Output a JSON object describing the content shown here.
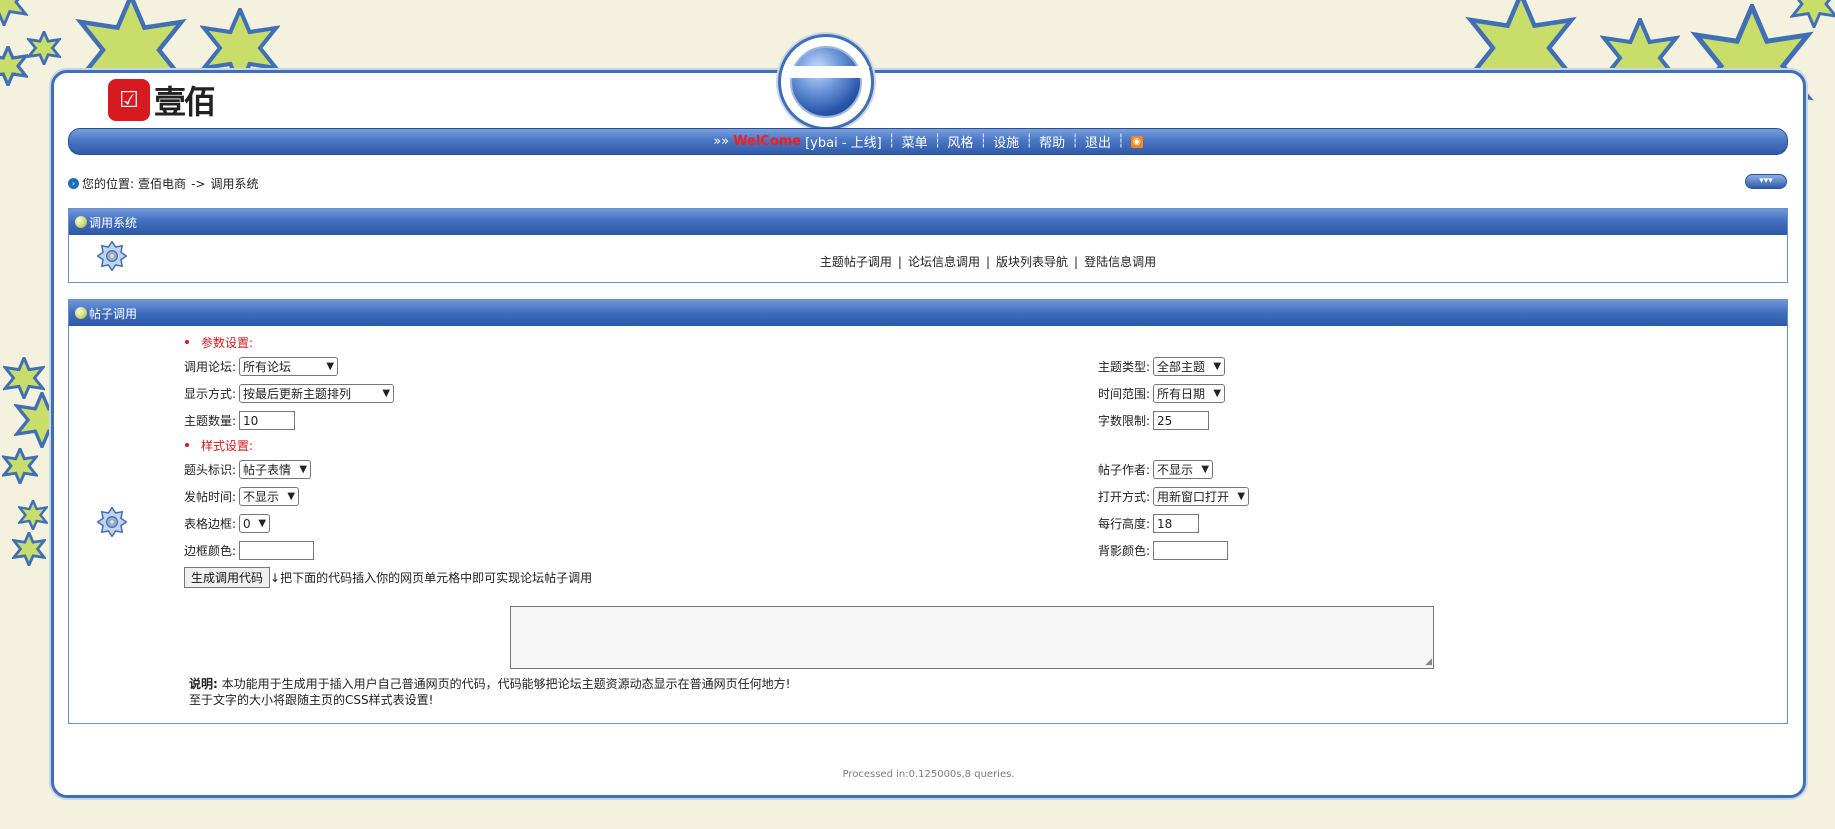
{
  "header": {
    "logo_mark": "☑",
    "logo_text": "壹佰",
    "nav": {
      "prefix": "»»",
      "welcome": "WelCome",
      "user_status": "[ybai - 上线]",
      "items": [
        "菜单",
        "风格",
        "设施",
        "帮助",
        "退出"
      ],
      "rss_icon": "rss-icon"
    }
  },
  "breadcrumb": {
    "label": "您的位置:",
    "site": "壹佰电商",
    "separator": "->",
    "current": "调用系统"
  },
  "panel_system": {
    "title": "调用系统",
    "links": [
      "主题帖子调用",
      "论坛信息调用",
      "版块列表导航",
      "登陆信息调用"
    ]
  },
  "panel_post": {
    "title": "帖子调用",
    "params_title": "参数设置:",
    "style_title": "样式设置:",
    "fields": {
      "forum_label": "调用论坛:",
      "forum_value": "所有论坛",
      "topic_type_label": "主题类型:",
      "topic_type_value": "全部主题",
      "display_label": "显示方式:",
      "display_value": "按最后更新主题排列",
      "time_label": "时间范围:",
      "time_value": "所有日期",
      "count_label": "主题数量:",
      "count_value": "10",
      "chars_label": "字数限制:",
      "chars_value": "25",
      "title_mark_label": "题头标识:",
      "title_mark_value": "帖子表情",
      "author_label": "帖子作者:",
      "author_value": "不显示",
      "post_time_label": "发帖时间:",
      "post_time_value": "不显示",
      "open_label": "打开方式:",
      "open_value": "用新窗口打开",
      "border_label": "表格边框:",
      "border_value": "0",
      "row_height_label": "每行高度:",
      "row_height_value": "18",
      "border_color_label": "边框颜色:",
      "border_color_value": "",
      "bg_color_label": "背影颜色:",
      "bg_color_value": ""
    },
    "generate_button": "生成调用代码",
    "generate_hint": "↓把下面的代码插入你的网页单元格中即可实现论坛帖子调用",
    "code_value": "",
    "note_label": "说明:",
    "note_line1": "本功能用于生成用于插入用户自己普通网页的代码，代码能够把论坛主题资源动态显示在普通网页任何地方!",
    "note_line2": "至于文字的大小将跟随主页的CSS样式表设置!"
  },
  "footer": {
    "processed": "Processed in:0.125000s,8 queries."
  },
  "colors": {
    "background": "#f4f1de",
    "frame_border": "#3f6fb6",
    "welcome": "#ff1a1a",
    "section_title": "#d41b1b"
  }
}
